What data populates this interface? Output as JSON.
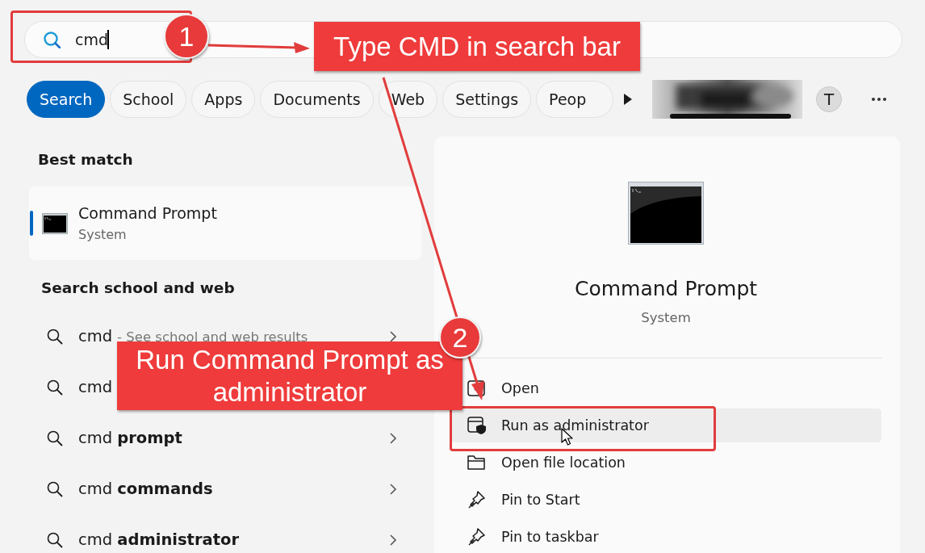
{
  "search_bar": {
    "value": "cmd"
  },
  "filters": [
    {
      "label": "Search",
      "selected": true
    },
    {
      "label": "School",
      "selected": false
    },
    {
      "label": "Apps",
      "selected": false
    },
    {
      "label": "Documents",
      "selected": false
    },
    {
      "label": "Web",
      "selected": false
    },
    {
      "label": "Settings",
      "selected": false
    },
    {
      "label": "Peop",
      "selected": false
    }
  ],
  "account_initial": "T",
  "best_match": {
    "heading": "Best match",
    "item": {
      "title": "Command Prompt",
      "subtitle": "System",
      "selected": true
    }
  },
  "web_results": {
    "heading": "Search school and web",
    "suggestions": [
      {
        "text": "cmd",
        "hint": "- See school and web results",
        "chevron": true
      },
      {
        "text": "cmd",
        "chevron": false
      },
      {
        "text": "cmd **prompt**",
        "chevron": true
      },
      {
        "text": "cmd **commands**",
        "chevron": true
      },
      {
        "text": "cmd **administrator**",
        "chevron": true
      }
    ]
  },
  "details": {
    "title": "Command Prompt",
    "subtitle": "System",
    "actions": [
      {
        "label": "Open",
        "kind": "open",
        "hovered": false
      },
      {
        "label": "Run as administrator",
        "kind": "admin",
        "hovered": true
      },
      {
        "label": "Open file location",
        "kind": "folder",
        "hovered": false
      },
      {
        "label": "Pin to Start",
        "kind": "pin",
        "hovered": false
      },
      {
        "label": "Pin to taskbar",
        "kind": "pin",
        "hovered": false
      }
    ]
  },
  "annotations": {
    "steps": [
      {
        "number": "1",
        "callout": "Type CMD in search bar"
      },
      {
        "number": "2",
        "callout": "Run Command Prompt as administrator"
      }
    ]
  }
}
